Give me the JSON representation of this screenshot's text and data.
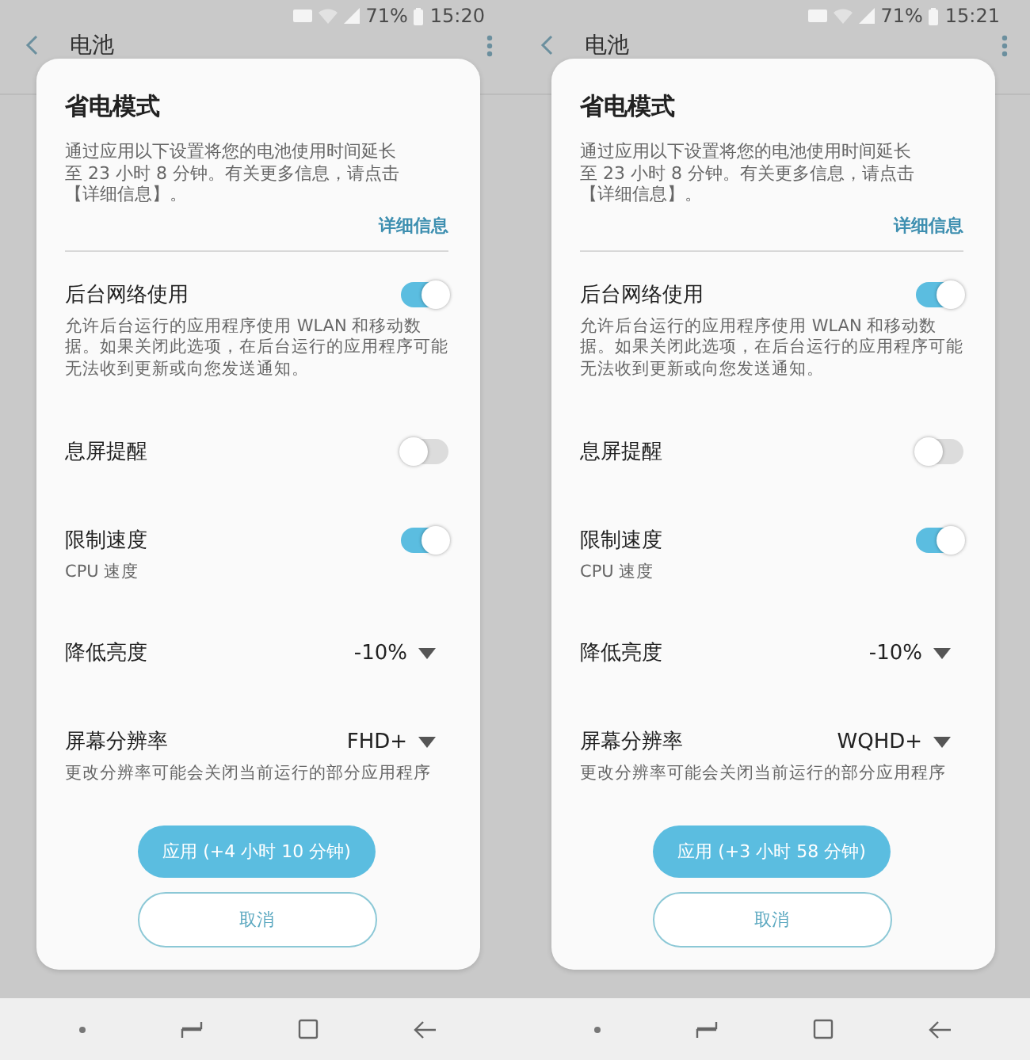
{
  "phones": [
    {
      "status": {
        "battery": "71%",
        "time": "15:20"
      },
      "header": {
        "title": "电池"
      },
      "dialog": {
        "title": "省电模式",
        "description": "通过应用以下设置将您的电池使用时间延长至 23 小时 8 分钟。有关更多信息，请点击【详细信息】。",
        "link": "详细信息",
        "settings": [
          {
            "kind": "toggle",
            "label": "后台网络使用",
            "on": true,
            "description": "允许后台运行的应用程序使用 WLAN 和移动数据。如果关闭此选项，在后台运行的应用程序可能无法收到更新或向您发送通知。"
          },
          {
            "kind": "toggle",
            "label": "息屏提醒",
            "on": false
          },
          {
            "kind": "toggle",
            "label": "限制速度",
            "on": true,
            "description": "CPU 速度"
          },
          {
            "kind": "dropdown",
            "label": "降低亮度",
            "value": "-10%"
          },
          {
            "kind": "dropdown",
            "label": "屏幕分辨率",
            "value": "FHD+",
            "description": "更改分辨率可能会关闭当前运行的部分应用程序"
          }
        ],
        "apply": "应用 (+4 小时 10 分钟)",
        "cancel": "取消"
      }
    },
    {
      "status": {
        "battery": "71%",
        "time": "15:21"
      },
      "header": {
        "title": "电池"
      },
      "dialog": {
        "title": "省电模式",
        "description": "通过应用以下设置将您的电池使用时间延长至 23 小时 8 分钟。有关更多信息，请点击【详细信息】。",
        "link": "详细信息",
        "settings": [
          {
            "kind": "toggle",
            "label": "后台网络使用",
            "on": true,
            "description": "允许后台运行的应用程序使用 WLAN 和移动数据。如果关闭此选项，在后台运行的应用程序可能无法收到更新或向您发送通知。"
          },
          {
            "kind": "toggle",
            "label": "息屏提醒",
            "on": false
          },
          {
            "kind": "toggle",
            "label": "限制速度",
            "on": true,
            "description": "CPU 速度"
          },
          {
            "kind": "dropdown",
            "label": "降低亮度",
            "value": "-10%"
          },
          {
            "kind": "dropdown",
            "label": "屏幕分辨率",
            "value": "WQHD+",
            "description": "更改分辨率可能会关闭当前运行的部分应用程序"
          }
        ],
        "apply": "应用 (+3 小时 58 分钟)",
        "cancel": "取消"
      }
    }
  ]
}
